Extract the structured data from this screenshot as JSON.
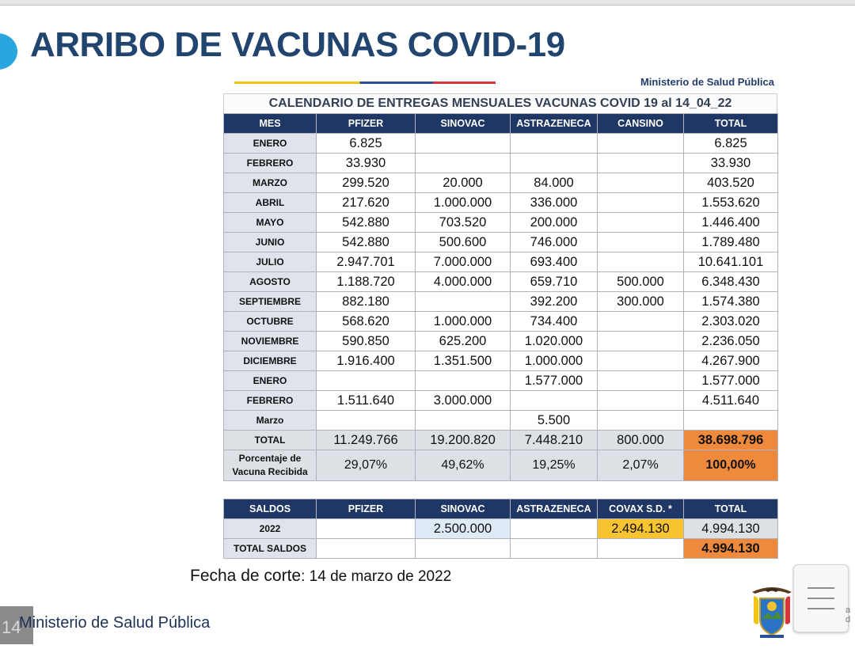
{
  "slide": {
    "title": "ARRIBO DE VACUNAS COVID-19",
    "page_number": "14",
    "footer_ministry": "Ministerio de Salud Pública",
    "edge_text": [
      "a",
      "d"
    ]
  },
  "sheet": {
    "ministry_label": "Ministerio de Salud Pública",
    "calendar_title": "CALENDARIO DE ENTREGAS MENSUALES VACUNAS COVID 19 al 14_04_22",
    "headers": [
      "MES",
      "PFIZER",
      "SINOVAC",
      "ASTRAZENECA",
      "CANSINO",
      "TOTAL"
    ],
    "rows": [
      [
        "ENERO",
        "6.825",
        "",
        "",
        "",
        "6.825"
      ],
      [
        "FEBRERO",
        "33.930",
        "",
        "",
        "",
        "33.930"
      ],
      [
        "MARZO",
        "299.520",
        "20.000",
        "84.000",
        "",
        "403.520"
      ],
      [
        "ABRIL",
        "217.620",
        "1.000.000",
        "336.000",
        "",
        "1.553.620"
      ],
      [
        "MAYO",
        "542.880",
        "703.520",
        "200.000",
        "",
        "1.446.400"
      ],
      [
        "JUNIO",
        "542.880",
        "500.600",
        "746.000",
        "",
        "1.789.480"
      ],
      [
        "JULIO",
        "2.947.701",
        "7.000.000",
        "693.400",
        "",
        "10.641.101"
      ],
      [
        "AGOSTO",
        "1.188.720",
        "4.000.000",
        "659.710",
        "500.000",
        "6.348.430"
      ],
      [
        "SEPTIEMBRE",
        "882.180",
        "",
        "392.200",
        "300.000",
        "1.574.380"
      ],
      [
        "OCTUBRE",
        "568.620",
        "1.000.000",
        "734.400",
        "",
        "2.303.020"
      ],
      [
        "NOVIEMBRE",
        "590.850",
        "625.200",
        "1.020.000",
        "",
        "2.236.050"
      ],
      [
        "DICIEMBRE",
        "1.916.400",
        "1.351.500",
        "1.000.000",
        "",
        "4.267.900"
      ],
      [
        "ENERO",
        "",
        "",
        "1.577.000",
        "",
        "1.577.000"
      ],
      [
        "FEBRERO",
        "1.511.640",
        "3.000.000",
        "",
        "",
        "4.511.640"
      ],
      [
        "Marzo",
        "",
        "",
        "5.500",
        "",
        ""
      ]
    ],
    "total_row": [
      "TOTAL",
      "11.249.766",
      "19.200.820",
      "7.448.210",
      "800.000",
      "38.698.796"
    ],
    "percent_row": {
      "label_line1": "Porcentaje de",
      "label_line2": "Vacuna Recibida",
      "values": [
        "29,07%",
        "49,62%",
        "19,25%",
        "2,07%",
        "100,00%"
      ]
    },
    "saldos_headers": [
      "SALDOS",
      "PFIZER",
      "SINOVAC",
      "ASTRAZENECA",
      "COVAX S.D. *",
      "TOTAL"
    ],
    "saldos_2022": [
      "2022",
      "",
      "2.500.000",
      "",
      "2.494.130",
      "4.994.130"
    ],
    "total_saldos": [
      "TOTAL SALDOS",
      "",
      "",
      "",
      "",
      "4.994.130"
    ]
  },
  "fecha": {
    "label": "Fecha de corte",
    "value": ": 14 de marzo de 2022"
  },
  "colors": {
    "title": "#21456f",
    "header_bg": "#1f3764",
    "highlight_orange": "#ef8a3c",
    "highlight_yellow": "#f7c331",
    "highlight_blue": "#dfeaf7"
  },
  "icons": [
    "ecuador-coat-of-arms-icon",
    "menu-icon"
  ]
}
